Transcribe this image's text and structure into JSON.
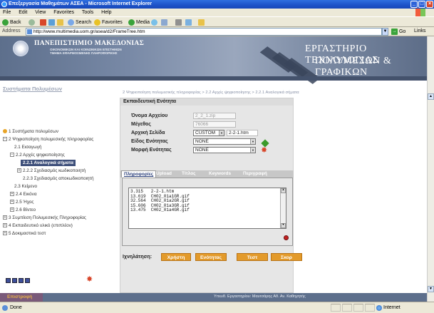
{
  "window": {
    "title": "Επεξεργασία Μαθημάτων ΑΣΕΑ - Microsoft Internet Explorer",
    "minimize": "_",
    "maximize": "□",
    "close": "×"
  },
  "menu": {
    "items": [
      "File",
      "Edit",
      "View",
      "Favorites",
      "Tools",
      "Help"
    ]
  },
  "toolbar": {
    "back": "Back",
    "search": "Search",
    "favorites": "Favorites",
    "media": "Media"
  },
  "address": {
    "label": "Address",
    "value": "http://www.multimedia.uom.gr/asea/d2/FrameTree.htm",
    "go": "Go",
    "links": "Links"
  },
  "banner": {
    "university": "ΠΑΝΕΠΙΣΤΗΜΙΟ ΜΑΚΕΔΟΝΙΑΣ",
    "sub1": "ΟΙΚΟΝΟΜΙΚΩΝ ΚΑΙ ΚΟΙΝΩΝΙΚΩΝ ΕΠΙΣΤΗΜΩΝ",
    "sub2": "ΤΜΗΜΑ ΕΦΑΡΜΟΣΜΕΝΗΣ ΠΛΗΡΟΦΟΡΙΚΗΣ",
    "lab_line1": "ΕΡΓΑΣΤΗΡΙΟ ΤΕΧΝΟΛΟΓΙΑΣ",
    "lab_line2": "ΠΟΛΥΜΕΣΩΝ & ΓΡΑΦΙΚΩΝ"
  },
  "sidebar": {
    "title": "Συστήματα Πολυμέσων",
    "items": [
      {
        "label": "1 Συστήματα πολυμέσων",
        "toggle": ""
      },
      {
        "label": "2 Ψηφιοποίηση πολυμεσικής πληροφορίας",
        "toggle": "−"
      },
      {
        "label": "2.1 Εισαγωγή",
        "toggle": ""
      },
      {
        "label": "2.2 Αρχές ψηφιοποίησης",
        "toggle": "−"
      },
      {
        "label": "2.2.1 Αναλογικά σήματα",
        "toggle": ""
      },
      {
        "label": "2.2.2 Σχεδιασμός κωδικοποιητή",
        "toggle": "+"
      },
      {
        "label": "2.2.3 Σχεδιασμός αποκωδικοποιητή",
        "toggle": ""
      },
      {
        "label": "2.3 Κείμενο",
        "toggle": ""
      },
      {
        "label": "2.4 Εικόνα",
        "toggle": "+"
      },
      {
        "label": "2.5 Ήχος",
        "toggle": "+"
      },
      {
        "label": "2.6 Βίντεο",
        "toggle": "+"
      },
      {
        "label": "3 Συμπίεση Πολυμεσικής Πληροφορίας",
        "toggle": "+"
      },
      {
        "label": "4 Εκπαιδευτικό υλικό (επιπλέον)",
        "toggle": "+"
      },
      {
        "label": "5 Δοκιμαστικά τεστ",
        "toggle": "+"
      }
    ]
  },
  "breadcrumb": "2 Ψηφιοποίηση πολυμεσικής πληροφορίας > 2.2 Αρχές ψηφιοποίησης > 2.2.1 Αναλογικά σήματα",
  "panel": {
    "title": "Εκπαιδευτική Ενότητα",
    "fields": {
      "filename_label": "Όνομα Αρχείου",
      "filename_value": "2_2_1.zip",
      "size_label": "Μέγεθος",
      "size_value": "76066",
      "startpage_label": "Αρχική Σελίδα",
      "startpage_select": "CUSTOM",
      "startpage_value": "2-2-1.htm",
      "type_label": "Είδος Ενότητας",
      "type_select": "NONE",
      "format_label": "Μορφή Ενότητας",
      "format_select": "NONE"
    },
    "tabs": [
      "Πληροφορίες",
      "Upload",
      "Τίτλος",
      "Keywords",
      "Περιγραφή"
    ],
    "info_rows": [
      "3.315   2-2-1.htm",
      "13.619  CH02_01a1GR.gif",
      "32.564  CH02_01a2GR.gif",
      "15.606  CH02_01a3GR.gif",
      "13.475  CH02_01a4GR.gif"
    ]
  },
  "tracking": {
    "label": "Ιχνηλάτηση:",
    "buttons": [
      "Χρήστη",
      "Ενότητας",
      "Τεστ",
      "Σκορ"
    ]
  },
  "bottombar": {
    "back_label": "Επιστροφή",
    "footer": "Υπευθ. Εργαστηρίου: Μαυτσάρης Αθ. Αν. Καθηγητής"
  },
  "status": {
    "text": "Done",
    "zone": "Internet"
  },
  "colors": {
    "accent": "#3d4f7a",
    "orange": "#e39a2a",
    "banner": "#5d6f8c"
  }
}
